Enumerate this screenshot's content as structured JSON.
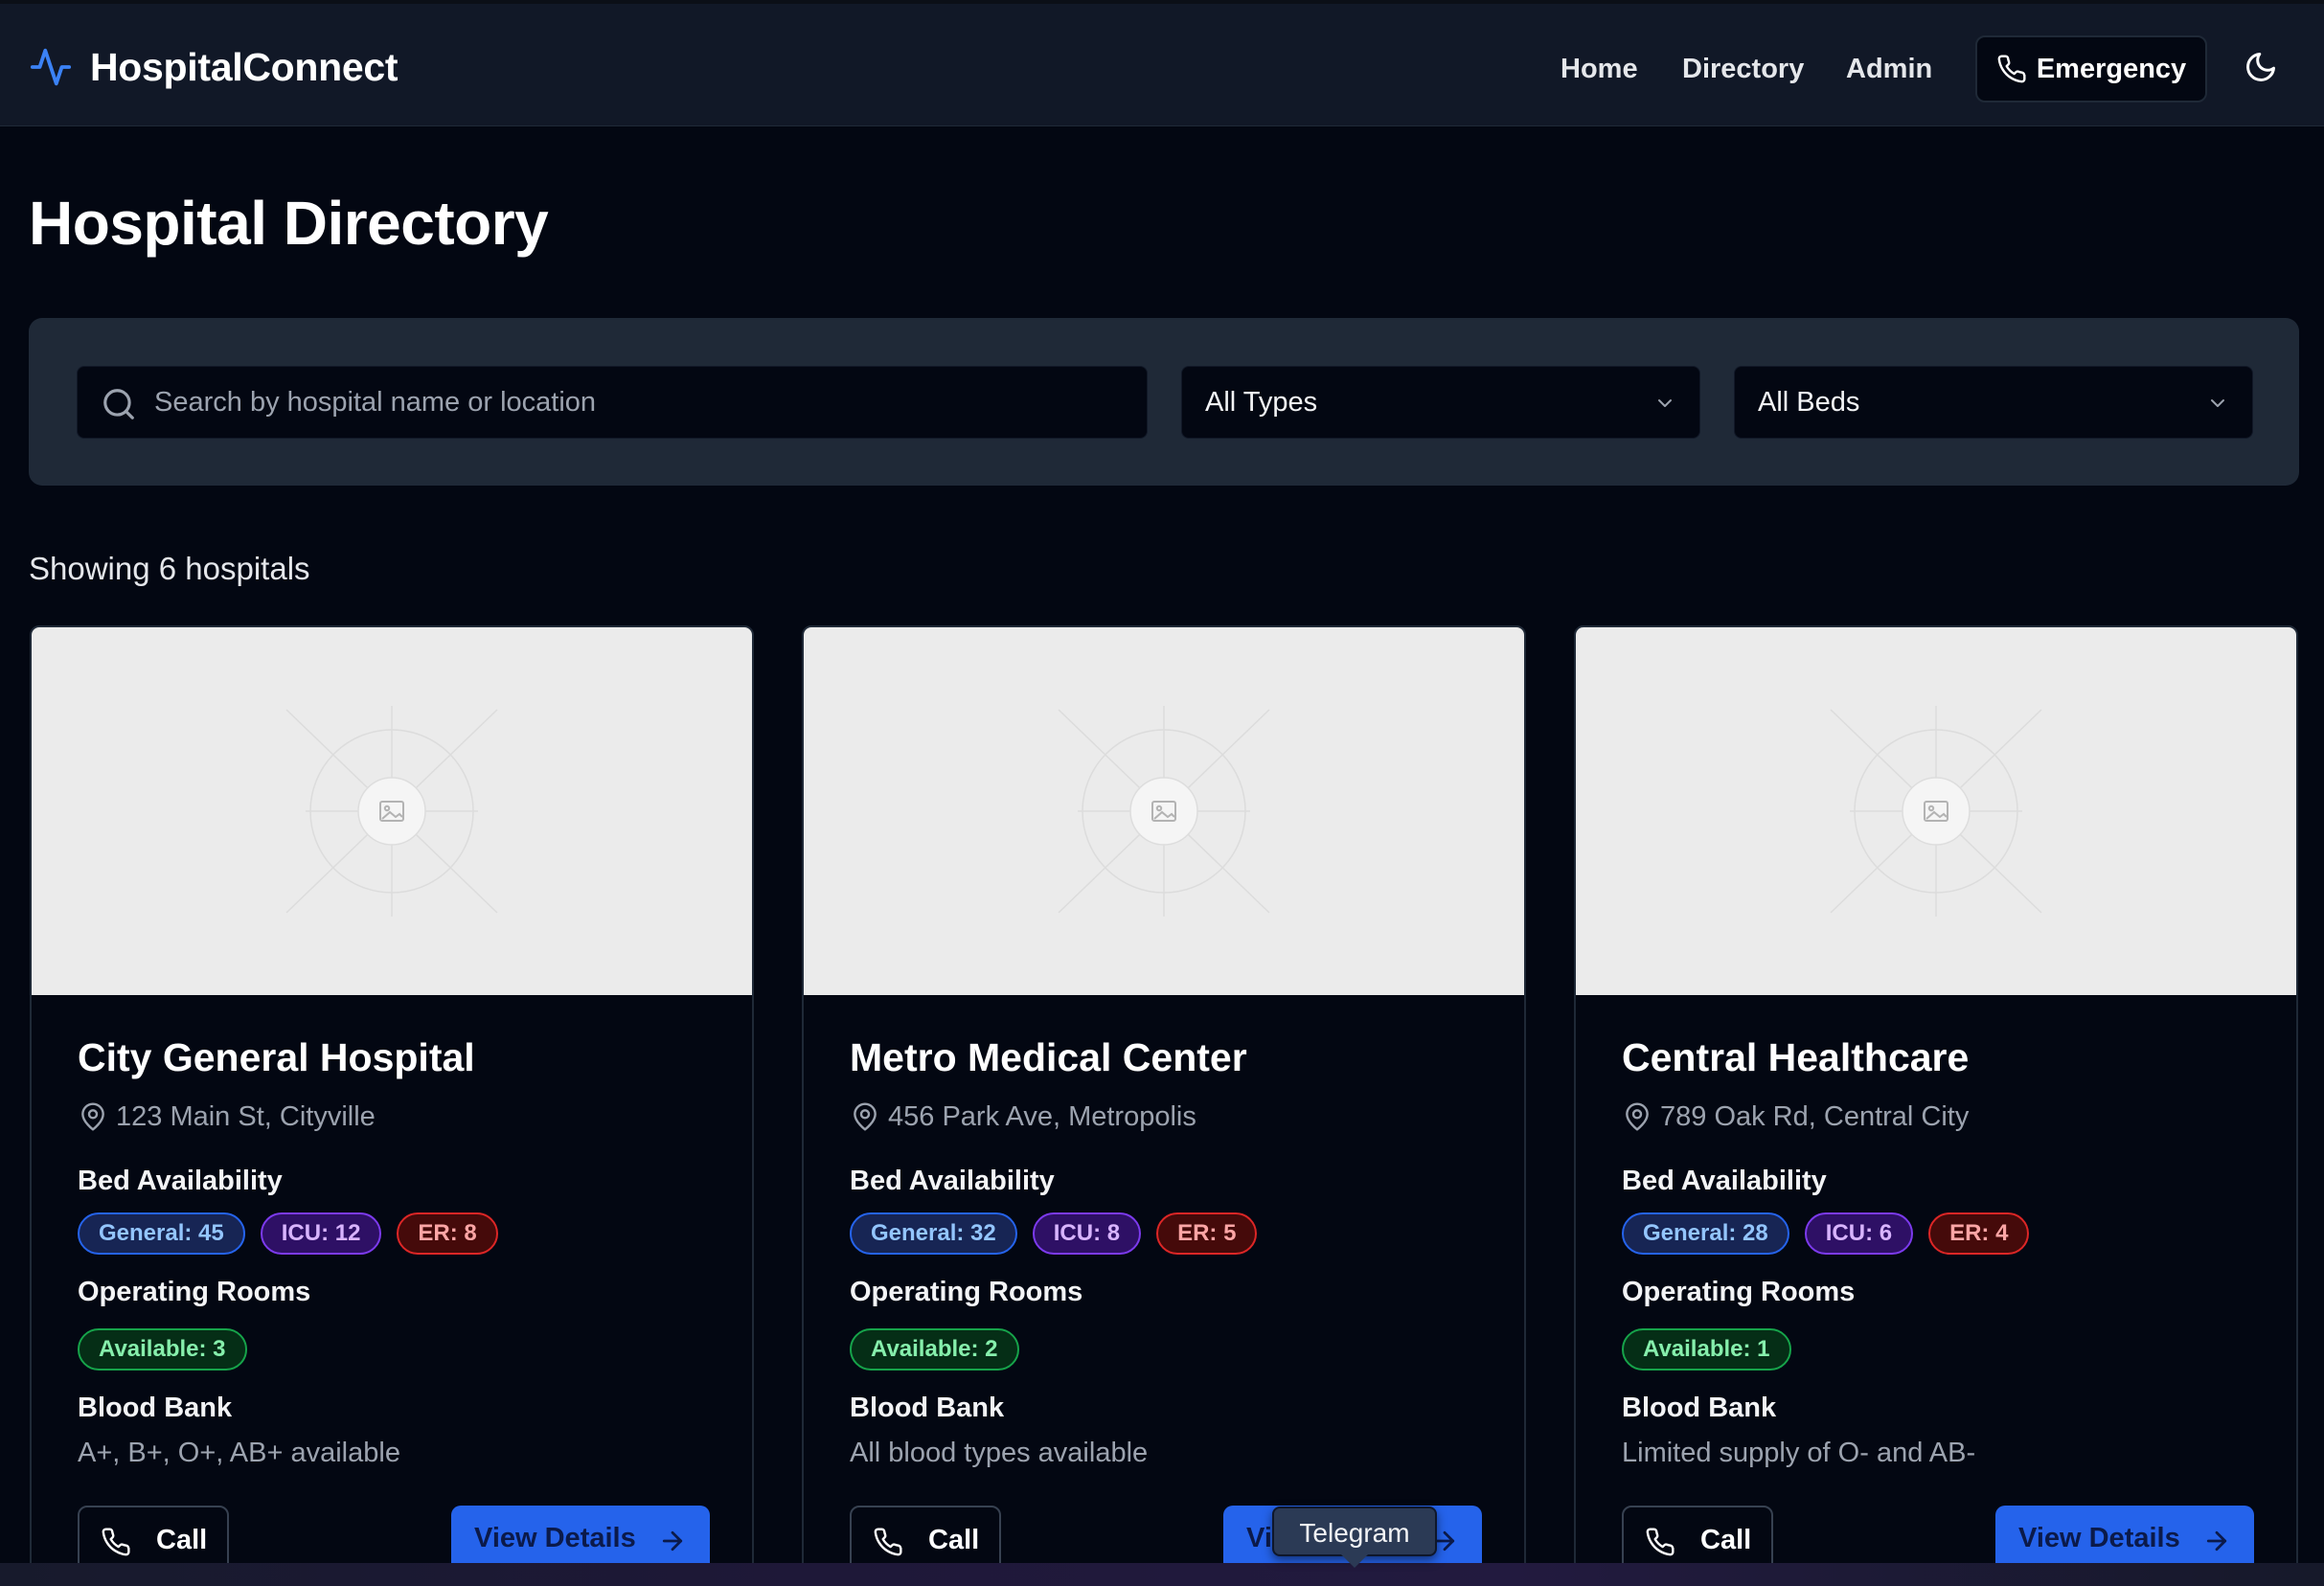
{
  "nav": {
    "brand": "HospitalConnect",
    "links": [
      "Home",
      "Directory",
      "Admin"
    ],
    "emergency_label": "Emergency",
    "theme_icon": "moon-icon",
    "accent_color": "#3b82f6"
  },
  "page": {
    "title": "Hospital Directory"
  },
  "filters": {
    "search_placeholder": "Search by hospital name or location",
    "type_selected": "All Types",
    "beds_selected": "All Beds"
  },
  "results": {
    "count_text": "Showing 6 hospitals"
  },
  "labels": {
    "bed_availability": "Bed Availability",
    "operating_rooms": "Operating Rooms",
    "blood_bank": "Blood Bank",
    "call": "Call",
    "view_details": "View Details"
  },
  "hospitals": [
    {
      "name": "City General Hospital",
      "address": "123 Main St, Cityville",
      "beds": {
        "general": "General: 45",
        "icu": "ICU: 12",
        "er": "ER: 8"
      },
      "or_available": "Available: 3",
      "blood": "A+, B+, O+, AB+ available"
    },
    {
      "name": "Metro Medical Center",
      "address": "456 Park Ave, Metropolis",
      "beds": {
        "general": "General: 32",
        "icu": "ICU: 8",
        "er": "ER: 5"
      },
      "or_available": "Available: 2",
      "blood": "All blood types available"
    },
    {
      "name": "Central Healthcare",
      "address": "789 Oak Rd, Central City",
      "beds": {
        "general": "General: 28",
        "icu": "ICU: 6",
        "er": "ER: 4"
      },
      "or_available": "Available: 1",
      "blood": "Limited supply of O- and AB-"
    }
  ],
  "tooltip": {
    "text": "Telegram"
  }
}
